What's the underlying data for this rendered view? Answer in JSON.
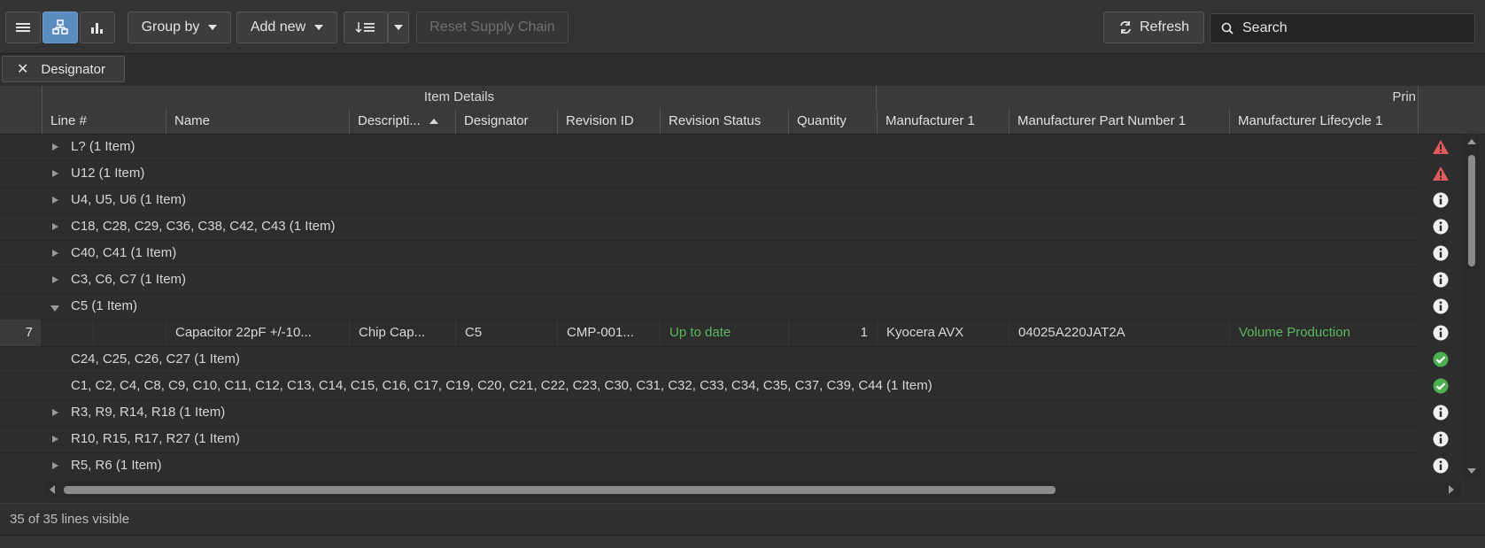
{
  "toolbar": {
    "view_buttons": [
      "list-view-icon",
      "tree-view-icon",
      "chart-view-icon"
    ],
    "group_by_label": "Group by",
    "add_new_label": "Add new",
    "reset_supply_chain_label": "Reset Supply Chain",
    "refresh_label": "Refresh",
    "search_placeholder": "Search"
  },
  "filter": {
    "chip_label": "Designator"
  },
  "grid": {
    "group_headers": [
      {
        "label": "Item Details"
      },
      {
        "label": "Prin"
      }
    ],
    "columns": [
      "Line #",
      "Name",
      "Descripti...",
      "Designator",
      "Revision ID",
      "Revision Status",
      "Quantity",
      "Manufacturer 1",
      "Manufacturer Part Number 1",
      "Manufacturer Lifecycle 1"
    ],
    "rows": [
      {
        "type": "group",
        "label": "L? (1 Item)",
        "expanded": false,
        "status": "warning"
      },
      {
        "type": "group",
        "label": "U12 (1 Item)",
        "expanded": false,
        "status": "warning"
      },
      {
        "type": "group",
        "label": "U4, U5, U6 (1 Item)",
        "expanded": false,
        "status": "info"
      },
      {
        "type": "group",
        "label": "C18, C28, C29, C36, C38, C42, C43 (1 Item)",
        "expanded": false,
        "status": "info"
      },
      {
        "type": "group",
        "label": "C40, C41 (1 Item)",
        "expanded": false,
        "status": "info"
      },
      {
        "type": "group",
        "label": "C3, C6, C7 (1 Item)",
        "expanded": false,
        "status": "info"
      },
      {
        "type": "group",
        "label": "C5 (1 Item)",
        "expanded": true,
        "status": "info"
      },
      {
        "type": "item",
        "line": "7",
        "name": "Capacitor 22pF +/-10...",
        "description": "Chip Cap...",
        "designator": "C5",
        "revision_id": "CMP-001...",
        "revision_status": "Up to date",
        "quantity": "1",
        "manufacturer": "Kyocera AVX",
        "mpn": "04025A220JAT2A",
        "lifecycle": "Volume Production",
        "status": "info"
      },
      {
        "type": "group",
        "label": "C24, C25, C26, C27 (1 Item)",
        "expanded": null,
        "status": "ok"
      },
      {
        "type": "group",
        "label": "C1, C2, C4, C8, C9, C10, C11, C12, C13, C14, C15, C16, C17, C19, C20, C21, C22, C23, C30, C31, C32, C33, C34, C35, C37, C39, C44 (1 Item)",
        "expanded": null,
        "status": "ok"
      },
      {
        "type": "group",
        "label": "R3, R9, R14, R18 (1 Item)",
        "expanded": false,
        "status": "info"
      },
      {
        "type": "group",
        "label": "R10, R15, R17, R27 (1 Item)",
        "expanded": false,
        "status": "info"
      },
      {
        "type": "group",
        "label": "R5, R6 (1 Item)",
        "expanded": false,
        "status": "info"
      }
    ]
  },
  "status_bar": {
    "text": "35 of 35 lines visible"
  },
  "colors": {
    "accent": "#5a8cc0",
    "warning": "#e05a5a",
    "ok": "#4caf50",
    "green_text": "#5db85d"
  }
}
